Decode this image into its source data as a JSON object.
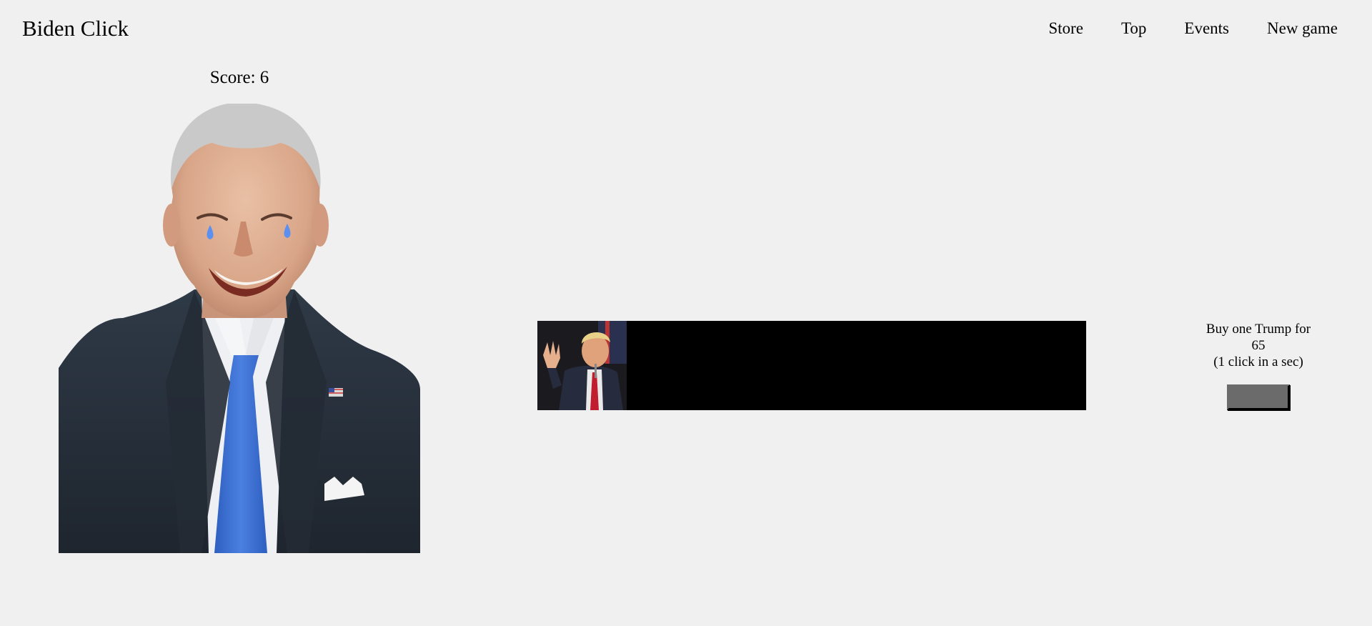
{
  "app": {
    "title": "Biden Click"
  },
  "nav": {
    "items": [
      "Store",
      "Top",
      "Events",
      "New game"
    ]
  },
  "game": {
    "score_label": "Score: 6"
  },
  "shop": {
    "offer_line1": "Buy one Trump for",
    "price": "65",
    "rate": "(1 click in a sec)",
    "buy_button_label": ""
  },
  "colors": {
    "page_bg": "#f0f0f0",
    "banner_bg": "#000000",
    "button_bg": "#6b6b6b",
    "tie": "#3d6fd1",
    "suit": "#26303b",
    "tears": "#5b8ff0"
  }
}
